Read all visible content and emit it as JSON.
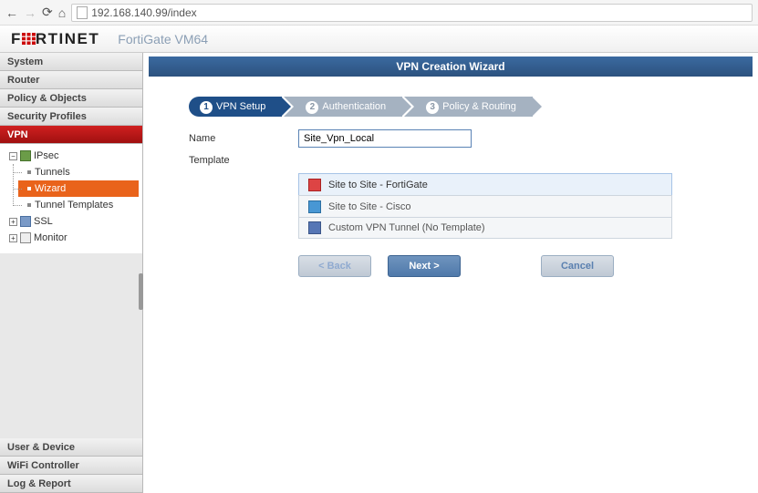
{
  "browser": {
    "url": "192.168.140.99/index"
  },
  "header": {
    "logo_pre": "F",
    "logo_post": "RTINET",
    "device": "FortiGate VM64"
  },
  "sidebar": {
    "top": [
      {
        "label": "System"
      },
      {
        "label": "Router"
      },
      {
        "label": "Policy & Objects"
      },
      {
        "label": "Security Profiles"
      },
      {
        "label": "VPN"
      }
    ],
    "tree": {
      "ipsec": "IPsec",
      "children": [
        "Tunnels",
        "Wizard",
        "Tunnel Templates"
      ],
      "ssl": "SSL",
      "monitor": "Monitor"
    },
    "bottom": [
      {
        "label": "User & Device"
      },
      {
        "label": "WiFi Controller"
      },
      {
        "label": "Log & Report"
      }
    ]
  },
  "wizard": {
    "title": "VPN Creation Wizard",
    "steps": [
      "VPN Setup",
      "Authentication",
      "Policy & Routing"
    ],
    "name_label": "Name",
    "name_value": "Site_Vpn_Local",
    "template_label": "Template",
    "options": [
      "Site to Site - FortiGate",
      "Site to Site - Cisco",
      "Custom VPN Tunnel (No Template)"
    ],
    "buttons": {
      "back": "< Back",
      "next": "Next >",
      "cancel": "Cancel"
    }
  }
}
